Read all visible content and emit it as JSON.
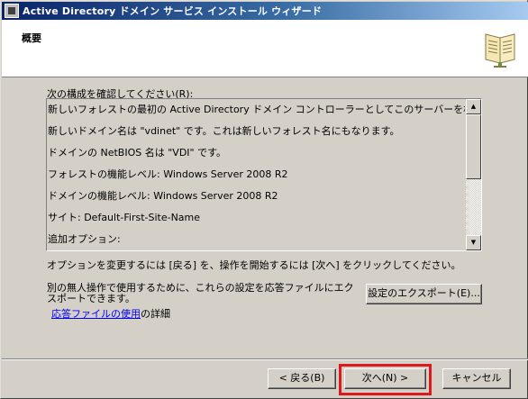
{
  "window": {
    "title": "Active Directory ドメイン サービス インストール ウィザード"
  },
  "header": {
    "title": "概要",
    "icon": "book-icon"
  },
  "main": {
    "confirm_label": "次の構成を確認してください(R):",
    "summary_lines": [
      "新しいフォレストの最初の Active Directory ドメイン コントローラーとしてこのサーバーを構成します。",
      "新しいドメイン名は \"vdinet\" です。これは新しいフォレスト名にもなります。",
      "ドメインの NetBIOS 名は \"VDI\" です。",
      "フォレストの機能レベル: Windows Server 2008 R2",
      "ドメインの機能レベル: Windows Server 2008 R2",
      "サイト: Default-First-Site-Name",
      "追加オプション:"
    ],
    "change_hint": "オプションを変更するには [戻る] を、操作を開始するには [次へ] をクリックしてください。",
    "export_hint": "別の無人操作で使用するために、これらの設定を応答ファイルにエクスポートできます。",
    "export_button": "設定のエクスポート(E)...",
    "answer_file_link": "応答ファイルの使用",
    "answer_file_suffix": "の詳細"
  },
  "footer": {
    "back_button": "< 戻る(B)",
    "next_button": "次へ(N) >",
    "cancel_button": "キャンセル"
  },
  "colors": {
    "titlebar_start": "#0a246a",
    "titlebar_end": "#a6caf0",
    "highlight": "#e0181e",
    "link": "#0000ff"
  }
}
